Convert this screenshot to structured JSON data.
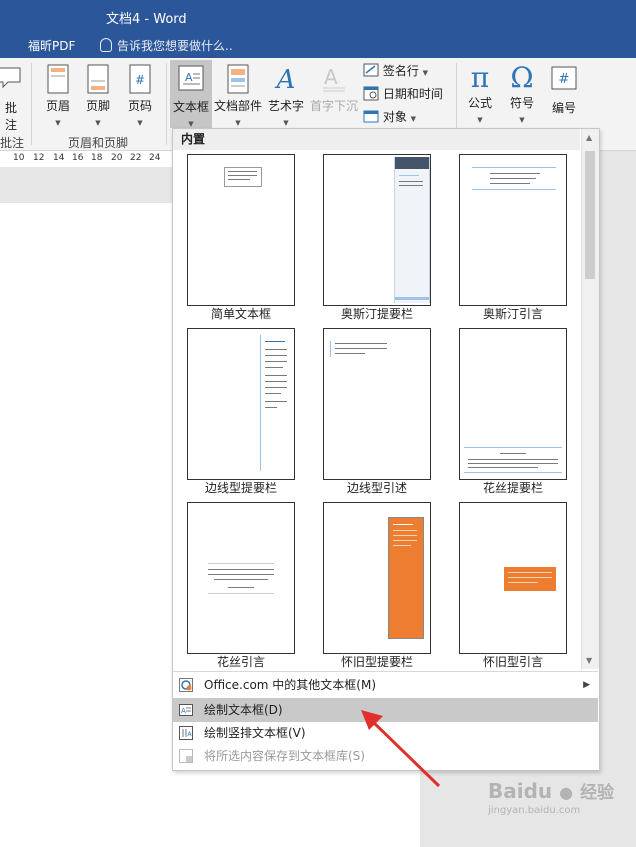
{
  "window": {
    "title": "文档4 - Word"
  },
  "tabs": {
    "foxit": "福昕PDF",
    "tell_me": "告诉我您想要做什么.."
  },
  "ribbon": {
    "comment_label": "批注",
    "comment_group": "批注",
    "header_label": "页眉",
    "footer_label": "页脚",
    "page_number_label": "页码",
    "header_footer_group": "页眉和页脚",
    "textbox_label": "文本框",
    "quick_parts_label": "文档部件",
    "wordart_label": "艺术字",
    "dropcap_label": "首字下沉",
    "signature_label": "签名行",
    "datetime_label": "日期和时间",
    "object_label": "对象",
    "equation_label": "公式",
    "symbol_label": "符号",
    "number_label": "编号"
  },
  "ruler": [
    "10",
    "12",
    "14",
    "16",
    "18",
    "20",
    "22",
    "24"
  ],
  "dropdown": {
    "header": "内置",
    "thumbnails": [
      {
        "label": "简单文本框",
        "style": "simple"
      },
      {
        "label": "奥斯汀提要栏",
        "style": "austin-sidebar"
      },
      {
        "label": "奥斯汀引言",
        "style": "austin-quote"
      },
      {
        "label": "边线型提要栏",
        "style": "edge-sidebar"
      },
      {
        "label": "边线型引述",
        "style": "edge-quote"
      },
      {
        "label": "花丝提要栏",
        "style": "filigree-sidebar"
      },
      {
        "label": "花丝引言",
        "style": "filigree-quote"
      },
      {
        "label": "怀旧型提要栏",
        "style": "retro-sidebar"
      },
      {
        "label": "怀旧型引言",
        "style": "retro-quote"
      }
    ],
    "menu": {
      "more_online": "Office.com 中的其他文本框(M)",
      "draw_textbox": "绘制文本框(D)",
      "draw_vertical": "绘制竖排文本框(V)",
      "save_selection": "将所选内容保存到文本框库(S)"
    }
  },
  "watermark": {
    "brand": "Baidu",
    "cn": "经验",
    "url": "jingyan.baidu.com"
  },
  "colors": {
    "title_bar": "#2b579a",
    "accent_orange": "#ed7d31",
    "accent_blue": "#2e75b6",
    "arrow_red": "#e0302b"
  }
}
